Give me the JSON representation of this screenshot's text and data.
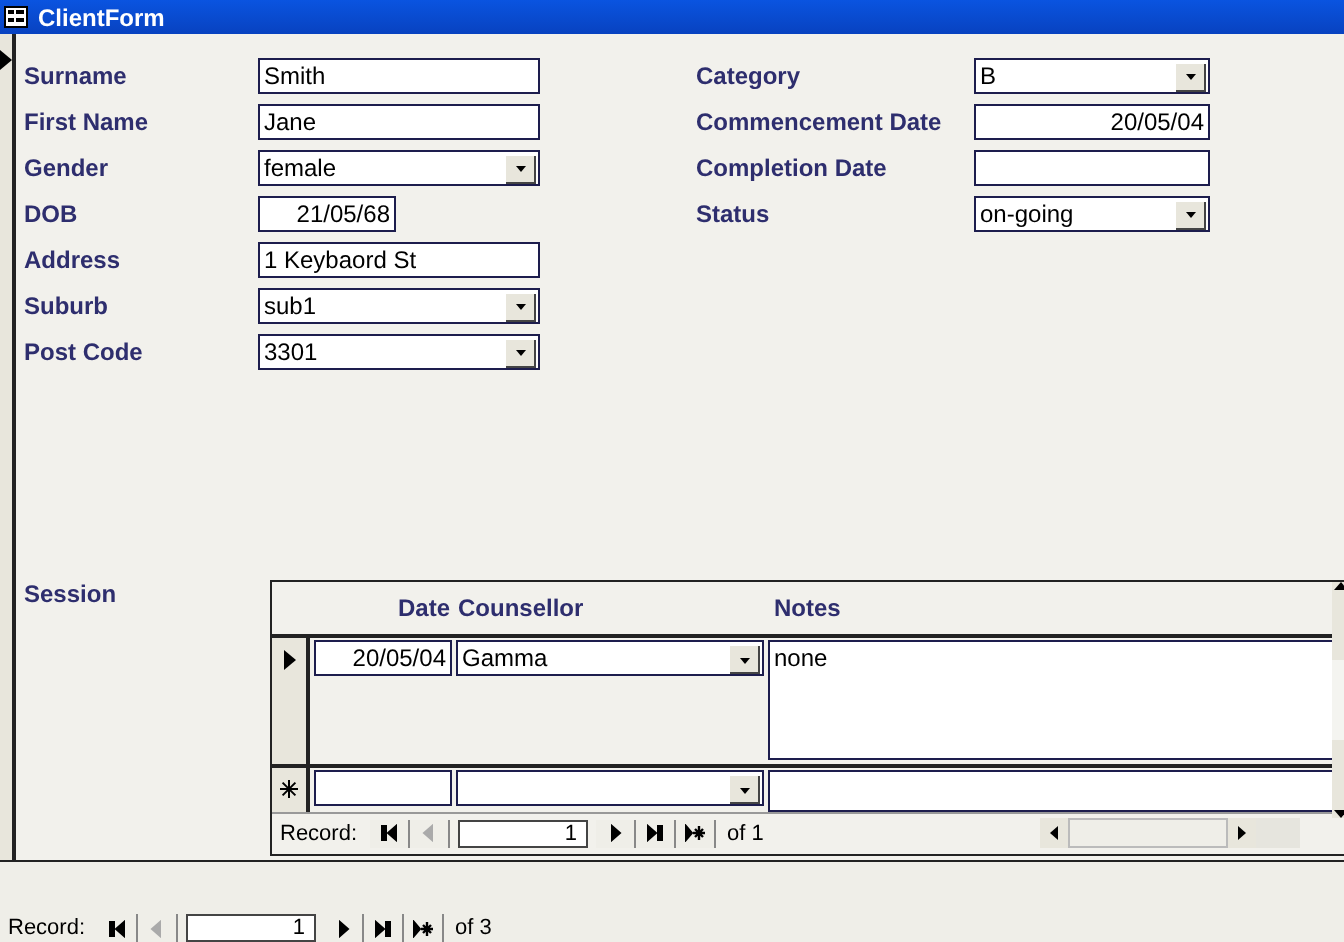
{
  "window": {
    "title": "ClientForm"
  },
  "left_fields": [
    {
      "label": "Surname",
      "value": "Smith",
      "kind": "text"
    },
    {
      "label": "First Name",
      "value": "Jane",
      "kind": "text"
    },
    {
      "label": "Gender",
      "value": "female",
      "kind": "combo"
    },
    {
      "label": "DOB",
      "value": "21/05/68",
      "kind": "date"
    },
    {
      "label": "Address",
      "value": "1 Keybaord St",
      "kind": "text"
    },
    {
      "label": "Suburb",
      "value": "sub1",
      "kind": "combo"
    },
    {
      "label": "Post Code",
      "value": "3301",
      "kind": "combo"
    }
  ],
  "right_fields": [
    {
      "label": "Category",
      "value": "B",
      "kind": "combo"
    },
    {
      "label": "Commencement Date",
      "value": "20/05/04",
      "kind": "date"
    },
    {
      "label": "Completion Date",
      "kind": "text"
    },
    {
      "label": "Status",
      "value": "on-going",
      "kind": "combo"
    }
  ],
  "session": {
    "label": "Session",
    "columns": [
      "Date",
      "Counsellor",
      "Notes"
    ],
    "rows": [
      {
        "date": "20/05/04",
        "counsellor": "Gamma",
        "notes": "none"
      }
    ],
    "navigation": {
      "label": "Record:",
      "current": "1",
      "total": "of 1",
      "buttons": [
        {
          "kind": "first",
          "disabled": false
        },
        {
          "kind": "prev",
          "disabled": true
        },
        {
          "kind": "next",
          "disabled": false
        },
        {
          "kind": "last",
          "disabled": false
        },
        {
          "kind": "new",
          "disabled": false
        }
      ]
    }
  },
  "navigation": {
    "label": "Record:",
    "current": "1",
    "total": "of 3",
    "buttons": [
      {
        "kind": "first",
        "disabled": false
      },
      {
        "kind": "prev",
        "disabled": true
      },
      {
        "kind": "next",
        "disabled": false
      },
      {
        "kind": "last",
        "disabled": false
      },
      {
        "kind": "new",
        "disabled": false
      }
    ]
  }
}
